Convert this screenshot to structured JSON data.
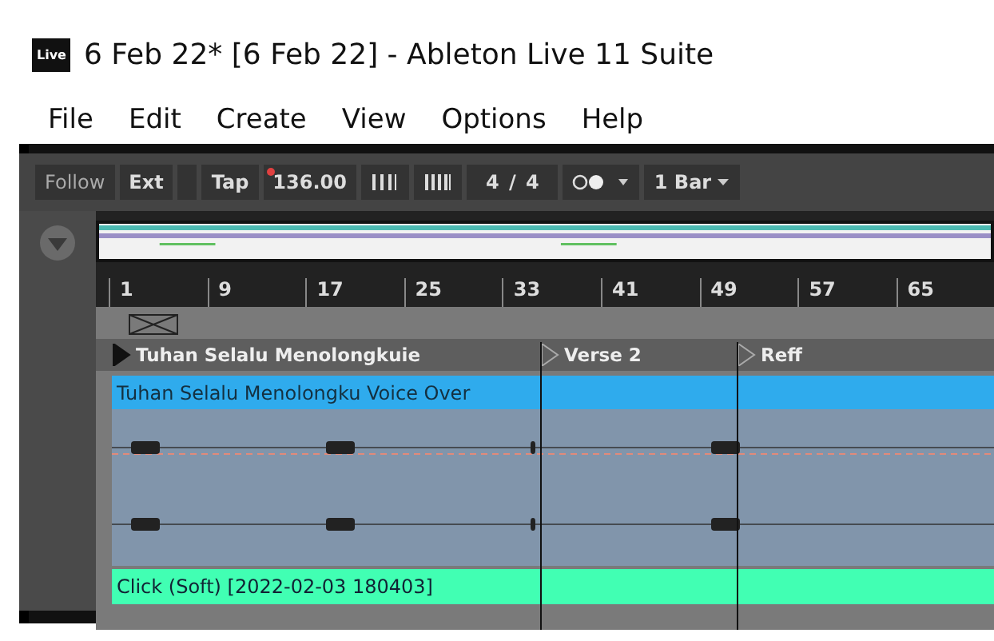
{
  "window": {
    "title": "6 Feb 22*  [6 Feb 22] - Ableton Live 11 Suite",
    "logo": "Live"
  },
  "menu": [
    "File",
    "Edit",
    "Create",
    "View",
    "Options",
    "Help"
  ],
  "control_bar": {
    "follow": "Follow",
    "ext": "Ext",
    "tap": "Tap",
    "tempo": "136.00",
    "signature": "4 / 4",
    "quantize": "1 Bar"
  },
  "ruler": [
    "1",
    "9",
    "17",
    "25",
    "33",
    "41",
    "49",
    "57",
    "65"
  ],
  "locators": [
    {
      "label": "Tuhan Selalu Menolongkuie",
      "selected": true
    },
    {
      "label": "Verse 2",
      "selected": false
    },
    {
      "label": "Reff",
      "selected": false
    }
  ],
  "clips": [
    {
      "name": "Tuhan Selalu Menolongku Voice Over",
      "color": "#2fabed"
    },
    {
      "name": "Click (Soft) [2022-02-03 180403]",
      "color": "#41ffb3"
    }
  ]
}
